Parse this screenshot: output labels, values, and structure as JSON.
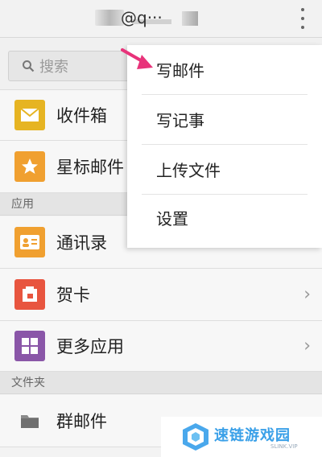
{
  "header": {
    "account": "@q···"
  },
  "search": {
    "placeholder": "搜索"
  },
  "items": [
    {
      "label": "收件箱",
      "color": "#e6b422"
    },
    {
      "label": "星标邮件",
      "color": "#f0a030"
    }
  ],
  "section_apps": "应用",
  "apps": [
    {
      "label": "通讯录",
      "color": "#f0a030"
    },
    {
      "label": "贺卡",
      "color": "#e8553f"
    },
    {
      "label": "更多应用",
      "color": "#8a56a8"
    }
  ],
  "section_folders": "文件夹",
  "folders": [
    {
      "label": "群邮件",
      "color": "#7a7a7a"
    }
  ],
  "menu": [
    "写邮件",
    "写记事",
    "上传文件",
    "设置"
  ],
  "watermark": {
    "title": "速链游戏园",
    "sub": "SLINK.VIP"
  }
}
